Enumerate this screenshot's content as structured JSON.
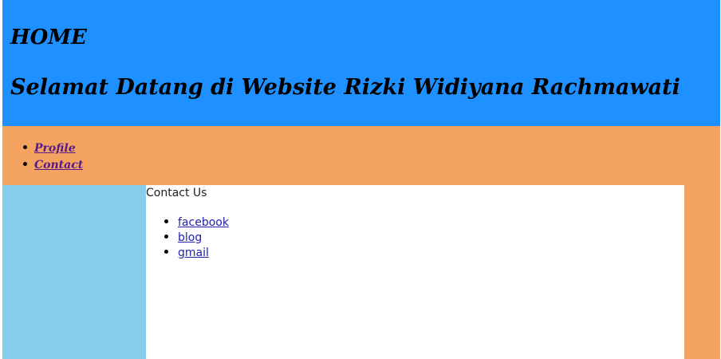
{
  "header": {
    "title": "HOME",
    "welcome": "Selamat Datang di Website Rizki Widiyana Rachmawati",
    "background_color": "#1e90ff"
  },
  "nav": {
    "background_color": "#f4a460",
    "items": [
      {
        "label": "Profile"
      },
      {
        "label": "Contact"
      }
    ]
  },
  "sidebar": {
    "background_color": "#87ceeb"
  },
  "content": {
    "title": "Contact Us",
    "links": [
      {
        "label": "facebook"
      },
      {
        "label": "blog"
      },
      {
        "label": "gmail"
      }
    ]
  }
}
